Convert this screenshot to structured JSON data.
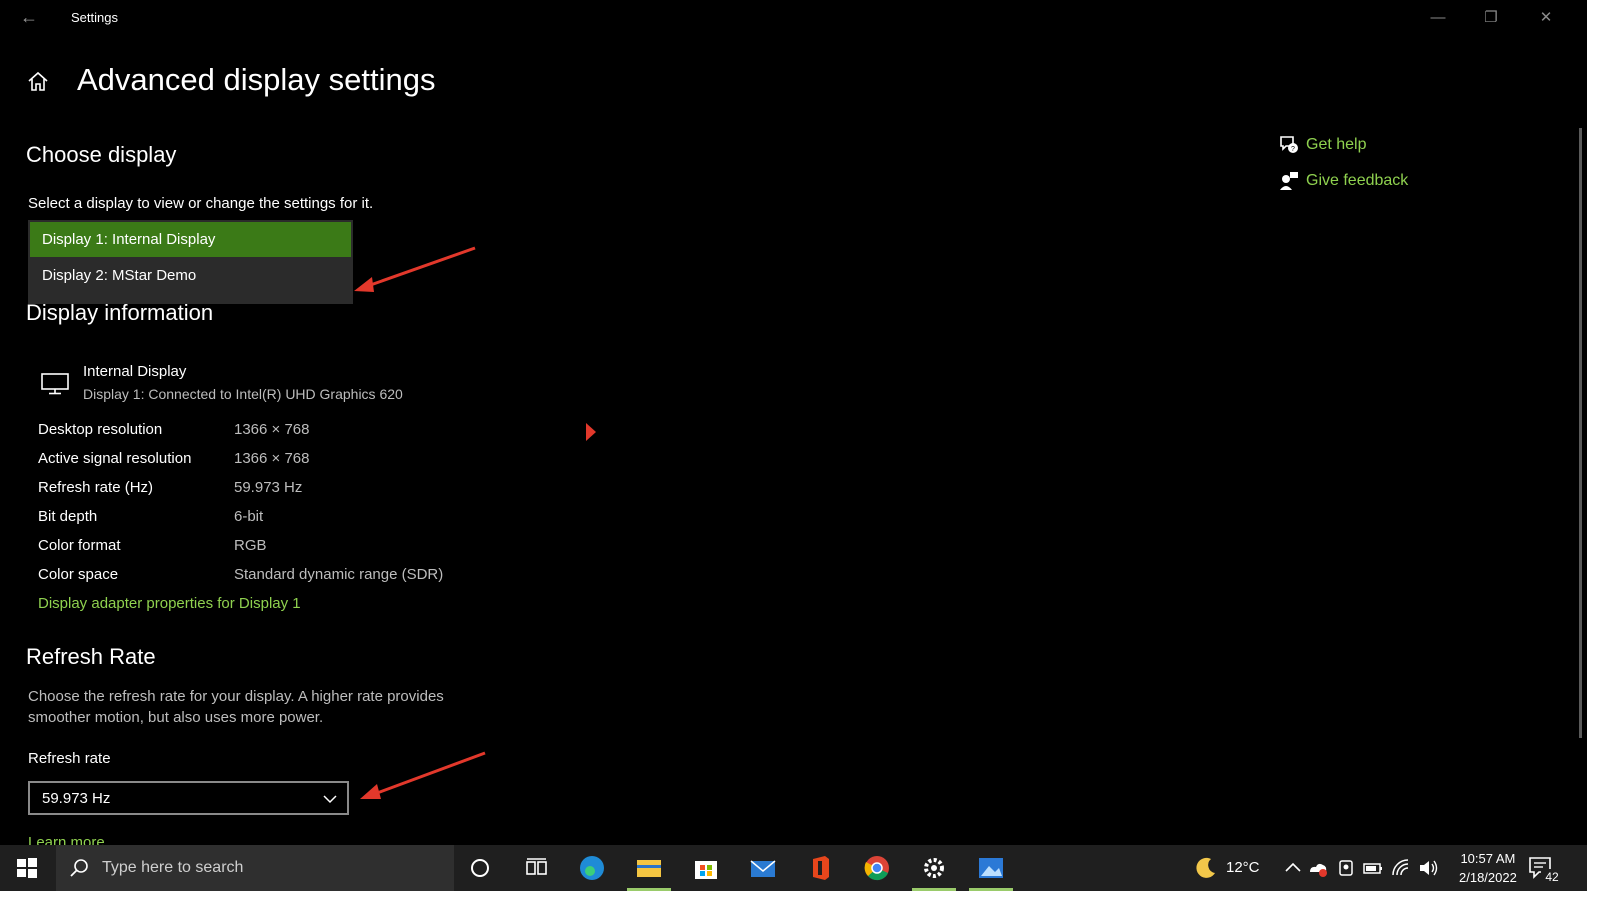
{
  "window": {
    "title": "Settings",
    "back_glyph": "←",
    "minimize_glyph": "—",
    "maximize_glyph": "❐",
    "close_glyph": "✕"
  },
  "page": {
    "title": "Advanced display settings"
  },
  "choose_display": {
    "heading": "Choose display",
    "description": "Select a display to view or change the settings for it.",
    "options": [
      "Display 1: Internal Display",
      "Display 2: MStar Demo"
    ],
    "selected_index": 0
  },
  "display_info": {
    "heading": "Display information",
    "monitor_name": "Internal Display",
    "monitor_detail": "Display 1: Connected to Intel(R) UHD Graphics 620",
    "rows": [
      {
        "label": "Desktop resolution",
        "value": "1366 × 768"
      },
      {
        "label": "Active signal resolution",
        "value": "1366 × 768"
      },
      {
        "label": "Refresh rate (Hz)",
        "value": "59.973 Hz"
      },
      {
        "label": "Bit depth",
        "value": "6-bit"
      },
      {
        "label": "Color format",
        "value": "RGB"
      },
      {
        "label": "Color space",
        "value": "Standard dynamic range (SDR)"
      }
    ],
    "adapter_link": "Display adapter properties for Display 1"
  },
  "refresh_rate": {
    "heading": "Refresh Rate",
    "description": "Choose the refresh rate for your display. A higher rate provides smoother motion, but also uses more power.",
    "field_label": "Refresh rate",
    "value": "59.973 Hz",
    "learn_more": "Learn more"
  },
  "side_links": {
    "help": "Get help",
    "feedback": "Give feedback"
  },
  "taskbar": {
    "search_placeholder": "Type here to search",
    "weather_temp": "12°C",
    "time": "10:57 AM",
    "date": "2/18/2022",
    "notification_count": "42"
  },
  "colors": {
    "accent_green": "#8fd14f",
    "selected_bg": "#3b7a17",
    "annotation_red": "#e2382b"
  }
}
